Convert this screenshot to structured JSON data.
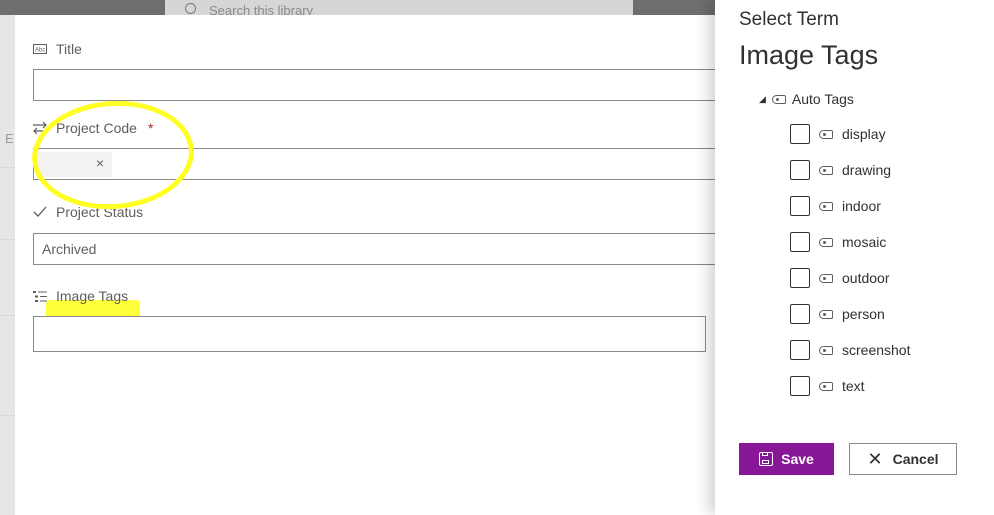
{
  "background": {
    "search_placeholder": "Search this library",
    "edge_letter": "E"
  },
  "form": {
    "fields": [
      {
        "label": "Title",
        "icon": "text-field-icon",
        "value": ""
      },
      {
        "label": "Project Code",
        "required_mark": "*",
        "icon": "switch-arrows-icon",
        "chip_remove": "×"
      },
      {
        "label": "Project Status",
        "icon": "checkmark-icon",
        "value": "Archived"
      },
      {
        "label": "Image Tags",
        "icon": "taxonomy-list-icon",
        "value": ""
      }
    ]
  },
  "panel": {
    "title": "Select Term",
    "heading": "Image Tags",
    "root": {
      "expander": "◢",
      "label": "Auto Tags"
    },
    "terms": [
      "display",
      "drawing",
      "indoor",
      "mosaic",
      "outdoor",
      "person",
      "screenshot",
      "text"
    ],
    "save_label": "Save",
    "cancel_label": "Cancel",
    "cancel_glyph": "✕"
  },
  "colors": {
    "accent_purple": "#881798",
    "highlight_yellow": "#ffff24",
    "required_red": "#a4262c"
  }
}
